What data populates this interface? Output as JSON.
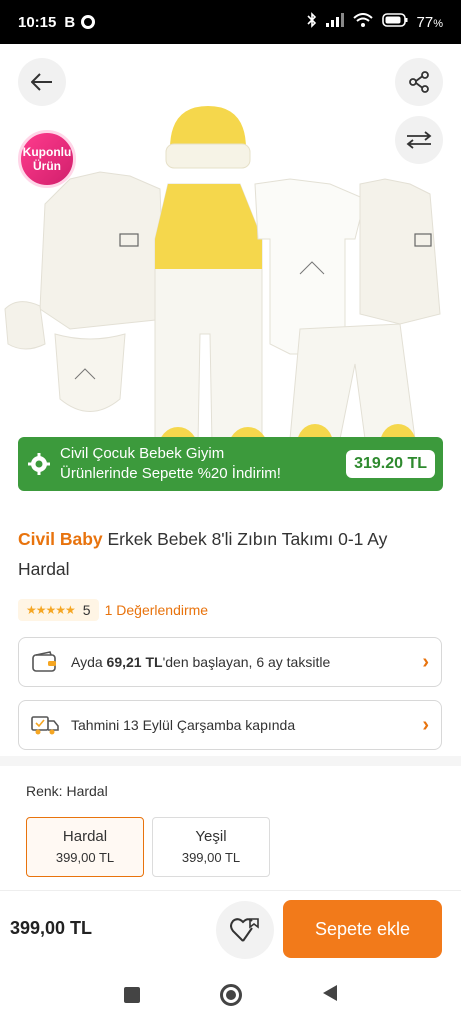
{
  "status_bar": {
    "time": "10:15",
    "app_badge": "B",
    "battery": "77"
  },
  "coupon_badge": {
    "line1": "Kuponlu",
    "line2": "Ürün"
  },
  "promo": {
    "text_line1": "Civil Çocuk Bebek Giyim",
    "text_line2": "Ürünlerinde Sepette %20 İndirim!",
    "price": "319.20 TL"
  },
  "product": {
    "brand": "Civil Baby",
    "name": "Erkek Bebek 8'li Zıbın Takımı 0-1 Ay Hardal"
  },
  "rating": {
    "score": "5",
    "reviews": "1 Değerlendirme"
  },
  "installment": {
    "prefix": "Ayda ",
    "amount": "69,21 TL",
    "suffix": "'den başlayan, 6 ay taksitle"
  },
  "delivery": {
    "text": "Tahmini 13 Eylül Çarşamba kapında"
  },
  "color": {
    "label": "Renk: Hardal",
    "variants": [
      {
        "name": "Hardal",
        "price": "399,00 TL"
      },
      {
        "name": "Yeşil",
        "price": "399,00 TL"
      }
    ]
  },
  "bottom": {
    "total": "399,00 TL",
    "add_to_cart": "Sepete ekle"
  },
  "colors": {
    "accent": "#f27a1a",
    "promo_green": "#3c9a3c",
    "yellow": "#f5d74c"
  }
}
